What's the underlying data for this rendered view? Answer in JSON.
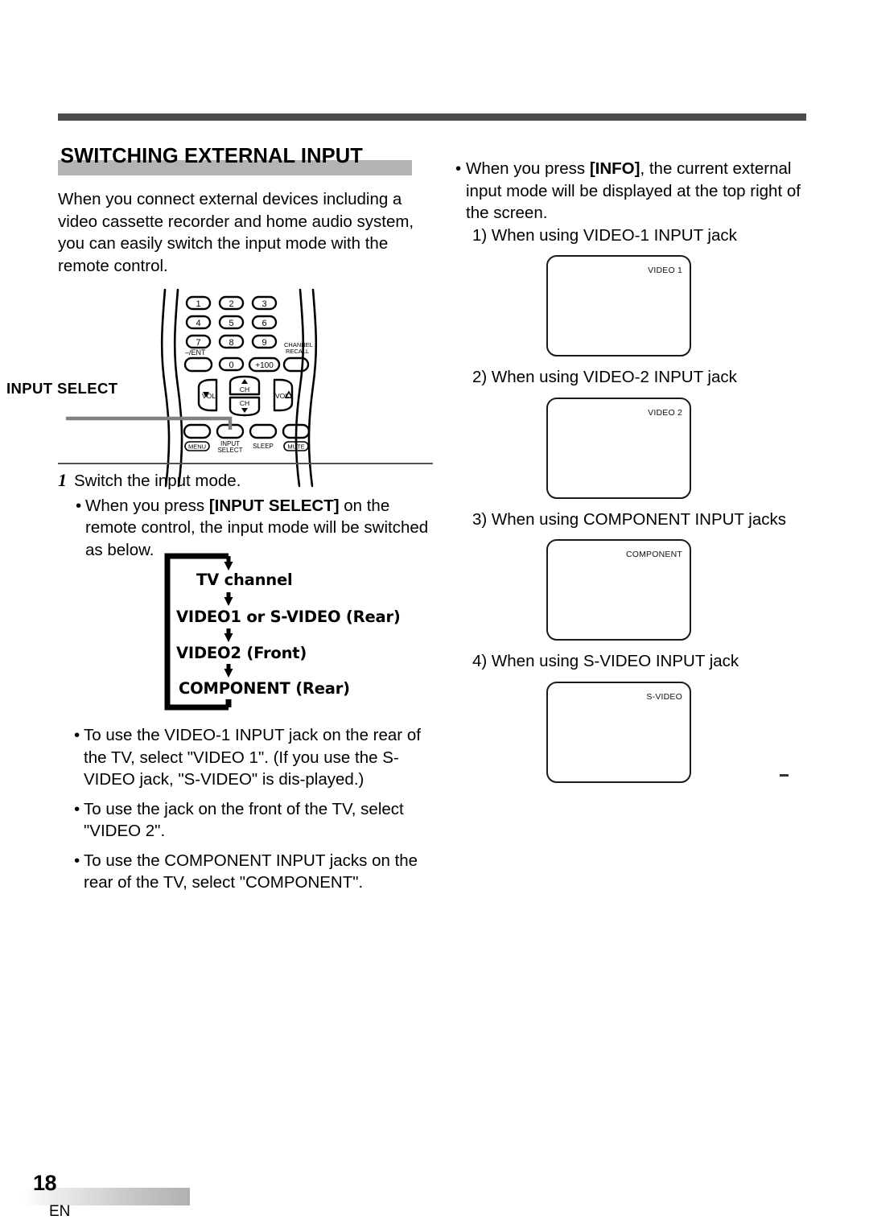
{
  "page": {
    "number": "18",
    "language_code": "EN"
  },
  "section": {
    "title": "SWITCHING EXTERNAL INPUT",
    "intro": "When you connect external devices including a video cassette recorder and home audio system, you can easily switch the input mode with the remote control."
  },
  "remote": {
    "callout_label": "INPUT SELECT",
    "keys": {
      "k1": "1",
      "k2": "2",
      "k3": "3",
      "k4": "4",
      "k5": "5",
      "k6": "6",
      "k7": "7",
      "k8": "8",
      "k9": "9",
      "k0": "0",
      "ent": "–/ENT",
      "plus100": "+100",
      "channel_recall_line1": "CHANNEL",
      "channel_recall_line2": "RECALL",
      "vol_down": "VOL",
      "vol_up": "VOL",
      "ch_up": "CH",
      "ch_down": "CH",
      "menu": "MENU",
      "input_select_line1": "INPUT",
      "input_select_line2": "SELECT",
      "sleep": "SLEEP",
      "mute": "MUTE"
    }
  },
  "step1": {
    "number": "1",
    "heading": "Switch the input mode.",
    "bullet_pre": "When you press ",
    "bullet_bold": "[INPUT SELECT]",
    "bullet_post": " on the remote control, the input mode will be switched as below."
  },
  "flow": {
    "items": [
      "TV channel",
      "VIDEO1 or S-VIDEO (Rear)",
      "VIDEO2 (Front)",
      "COMPONENT (Rear)"
    ]
  },
  "tail_bullets": [
    "To use the VIDEO-1 INPUT jack on the rear of the TV, select \"VIDEO 1\".\n(If you use the S-VIDEO jack, \"S-VIDEO\" is dis-played.)",
    "To use the jack on the front of the TV, select \"VIDEO 2\".",
    "To use the COMPONENT INPUT jacks on the rear of the TV, select \"COMPONENT\"."
  ],
  "right_column": {
    "info_bullet_pre": "When you press ",
    "info_bullet_bold": "[INFO]",
    "info_bullet_post": ", the current external input mode will be displayed at the top right of the screen.",
    "cases": [
      {
        "caption": "1) When using VIDEO-1 INPUT jack",
        "osd": "VIDEO 1"
      },
      {
        "caption": "2) When using VIDEO-2 INPUT jack",
        "osd": "VIDEO 2"
      },
      {
        "caption": "3) When using COMPONENT INPUT jacks",
        "osd": "COMPONENT"
      },
      {
        "caption": "4) When using S-VIDEO INPUT jack",
        "osd": "S-VIDEO"
      }
    ]
  },
  "colors": {
    "top_rule": "#4d4d4d",
    "title_highlight": "#b3b3b3",
    "ink": "#000000"
  }
}
